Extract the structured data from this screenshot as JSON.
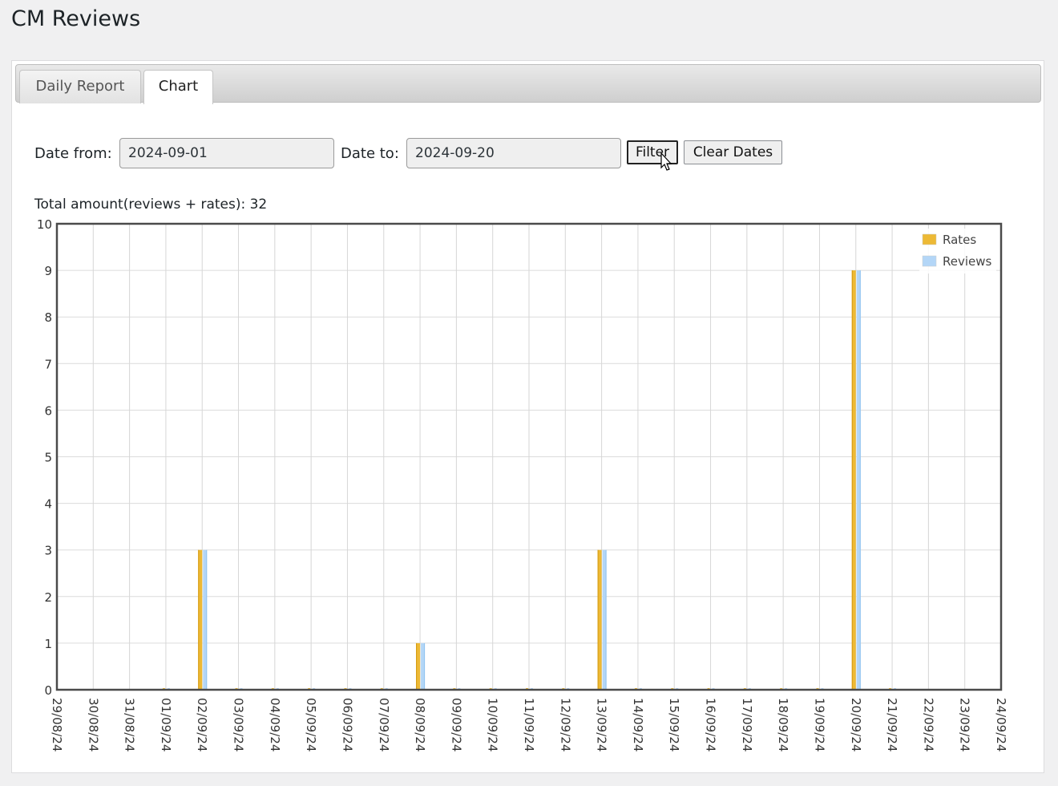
{
  "page": {
    "title": "CM Reviews"
  },
  "tabs": [
    {
      "label": "Daily Report"
    },
    {
      "label": "Chart",
      "active": true
    }
  ],
  "filter": {
    "date_from_label": "Date from:",
    "date_from_value": "2024-09-01",
    "date_to_label": "Date to:",
    "date_to_value": "2024-09-20",
    "filter_button": "Filter",
    "clear_button": "Clear Dates"
  },
  "total_text": "Total amount(reviews + rates): 32",
  "chart_data": {
    "type": "bar",
    "categories": [
      "29/08/24",
      "30/08/24",
      "31/08/24",
      "01/09/24",
      "02/09/24",
      "03/09/24",
      "04/09/24",
      "05/09/24",
      "06/09/24",
      "07/09/24",
      "08/09/24",
      "09/09/24",
      "10/09/24",
      "11/09/24",
      "12/09/24",
      "13/09/24",
      "14/09/24",
      "15/09/24",
      "16/09/24",
      "17/09/24",
      "18/09/24",
      "19/09/24",
      "20/09/24",
      "21/09/24",
      "22/09/24",
      "23/09/24",
      "24/09/24"
    ],
    "series": [
      {
        "name": "Rates",
        "color": "#edb935",
        "values": [
          null,
          null,
          null,
          0,
          3,
          0,
          0,
          0,
          0,
          0,
          1,
          0,
          0,
          0,
          0,
          3,
          0,
          0,
          0,
          0,
          0,
          0,
          9,
          0,
          null,
          null,
          null
        ]
      },
      {
        "name": "Reviews",
        "color": "#b3d6f7",
        "values": [
          null,
          null,
          null,
          0,
          3,
          0,
          0,
          0,
          0,
          0,
          1,
          0,
          0,
          0,
          0,
          3,
          0,
          0,
          0,
          0,
          0,
          0,
          9,
          0,
          null,
          null,
          null
        ]
      }
    ],
    "ylim": [
      0,
      10
    ],
    "yticks": [
      0,
      1,
      2,
      3,
      4,
      5,
      6,
      7,
      8,
      9,
      10
    ],
    "grid": true,
    "legend_position": "top-right"
  }
}
